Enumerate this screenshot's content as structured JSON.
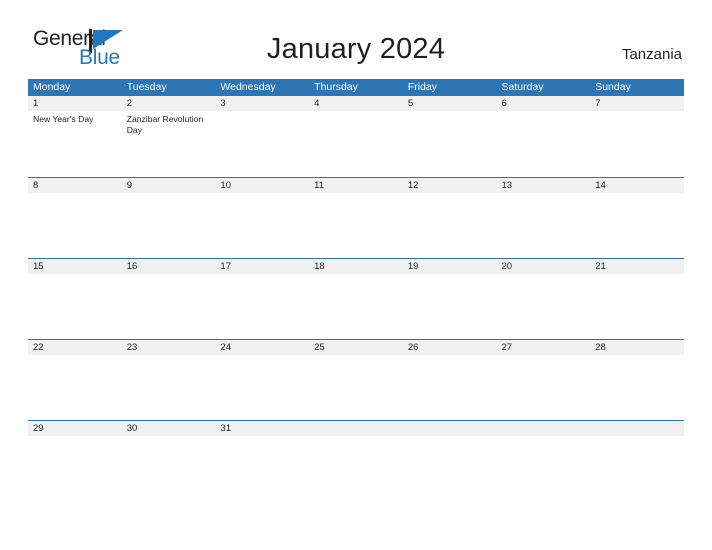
{
  "brand": {
    "name_part1": "General",
    "name_part2": "Blue",
    "flag_icon": "flag-triangle-icon",
    "accent_color": "#1f78c1"
  },
  "header": {
    "title": "January 2024",
    "region": "Tanzania"
  },
  "theme": {
    "header_blue": "#2e75b6",
    "date_band_gray": "#f0f0f0",
    "text_dark": "#231f20",
    "white": "#ffffff"
  },
  "calendar": {
    "month": "January",
    "year": "2024",
    "weekday_headers": [
      "Monday",
      "Tuesday",
      "Wednesday",
      "Thursday",
      "Friday",
      "Saturday",
      "Sunday"
    ],
    "weeks": [
      {
        "days": [
          {
            "date": "1",
            "events": [
              "New Year's Day"
            ]
          },
          {
            "date": "2",
            "events": [
              "Zanzibar Revolution Day"
            ]
          },
          {
            "date": "3",
            "events": []
          },
          {
            "date": "4",
            "events": []
          },
          {
            "date": "5",
            "events": []
          },
          {
            "date": "6",
            "events": []
          },
          {
            "date": "7",
            "events": []
          }
        ]
      },
      {
        "days": [
          {
            "date": "8",
            "events": []
          },
          {
            "date": "9",
            "events": []
          },
          {
            "date": "10",
            "events": []
          },
          {
            "date": "11",
            "events": []
          },
          {
            "date": "12",
            "events": []
          },
          {
            "date": "13",
            "events": []
          },
          {
            "date": "14",
            "events": []
          }
        ]
      },
      {
        "days": [
          {
            "date": "15",
            "events": []
          },
          {
            "date": "16",
            "events": []
          },
          {
            "date": "17",
            "events": []
          },
          {
            "date": "18",
            "events": []
          },
          {
            "date": "19",
            "events": []
          },
          {
            "date": "20",
            "events": []
          },
          {
            "date": "21",
            "events": []
          }
        ]
      },
      {
        "days": [
          {
            "date": "22",
            "events": []
          },
          {
            "date": "23",
            "events": []
          },
          {
            "date": "24",
            "events": []
          },
          {
            "date": "25",
            "events": []
          },
          {
            "date": "26",
            "events": []
          },
          {
            "date": "27",
            "events": []
          },
          {
            "date": "28",
            "events": []
          }
        ]
      },
      {
        "days": [
          {
            "date": "29",
            "events": []
          },
          {
            "date": "30",
            "events": []
          },
          {
            "date": "31",
            "events": []
          },
          {
            "date": "",
            "events": []
          },
          {
            "date": "",
            "events": []
          },
          {
            "date": "",
            "events": []
          },
          {
            "date": "",
            "events": []
          }
        ]
      }
    ]
  }
}
